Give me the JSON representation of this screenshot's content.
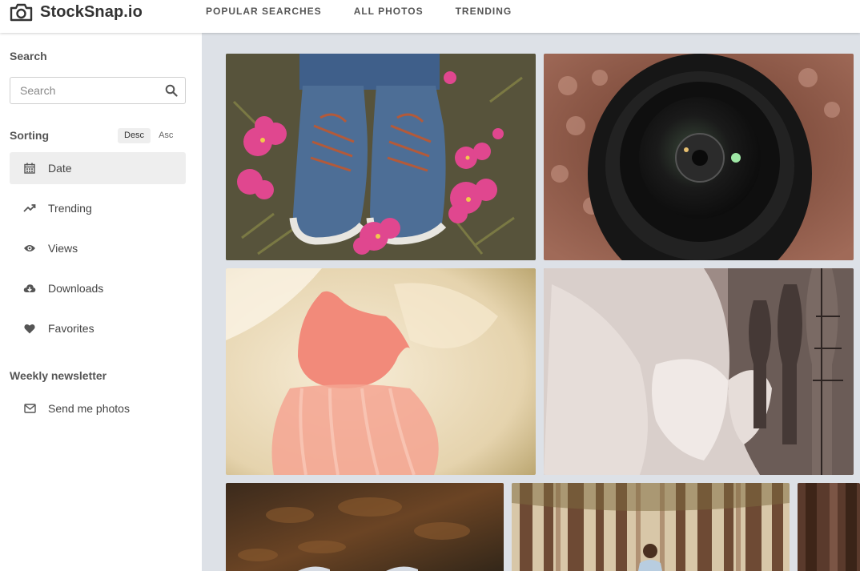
{
  "header": {
    "brand": "StockSnap.io",
    "nav": [
      {
        "label": "POPULAR SEARCHES"
      },
      {
        "label": "ALL PHOTOS"
      },
      {
        "label": "TRENDING"
      }
    ]
  },
  "sidebar": {
    "search": {
      "heading": "Search",
      "placeholder": "Search",
      "value": ""
    },
    "sorting": {
      "heading": "Sorting",
      "desc_label": "Desc",
      "asc_label": "Asc",
      "selected_order": "Desc",
      "items": [
        {
          "label": "Date",
          "icon": "calendar-icon",
          "active": true
        },
        {
          "label": "Trending",
          "icon": "trending-icon",
          "active": false
        },
        {
          "label": "Views",
          "icon": "eye-icon",
          "active": false
        },
        {
          "label": "Downloads",
          "icon": "cloud-download-icon",
          "active": false
        },
        {
          "label": "Favorites",
          "icon": "heart-icon",
          "active": false
        }
      ]
    },
    "newsletter": {
      "heading": "Weekly newsletter",
      "item_label": "Send me photos",
      "icon": "envelope-icon"
    }
  },
  "gallery": {
    "background_color": "#dde1e7",
    "photos": [
      {
        "subject": "blue sneakers on pink flowers"
      },
      {
        "subject": "camera lens close-up"
      },
      {
        "subject": "pink heart tutu dress"
      },
      {
        "subject": "dress forms in a tailor shop"
      },
      {
        "subject": "shoes on autumn leaves"
      },
      {
        "subject": "woman walking in a forest"
      },
      {
        "subject": "forest trees"
      }
    ]
  }
}
